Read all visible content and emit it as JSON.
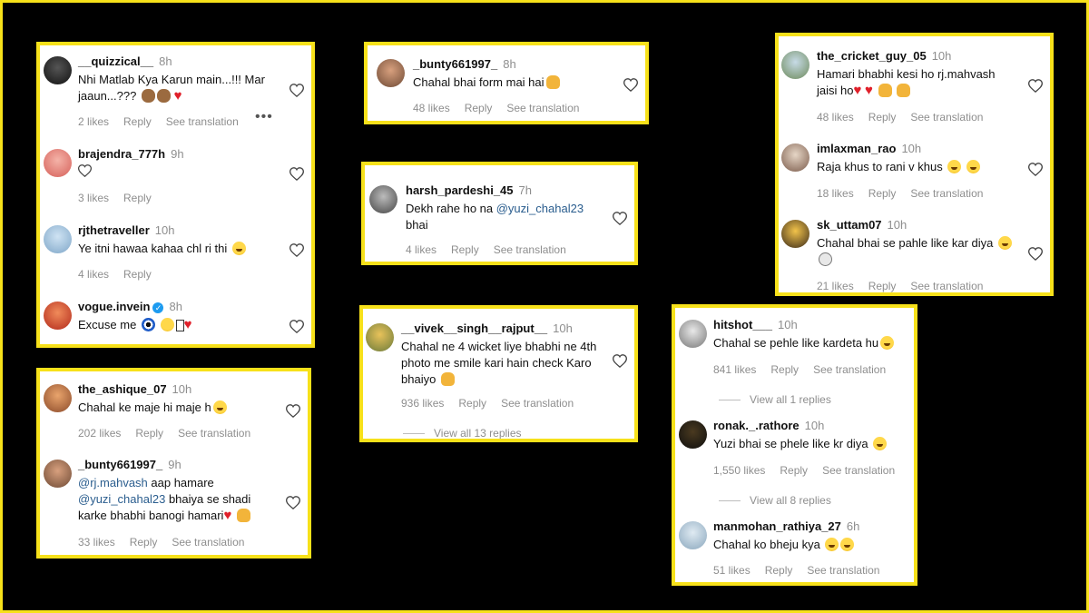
{
  "cards": {
    "c1": [
      {
        "user": "__quizzical__",
        "time": "8h",
        "text": "Nhi Matlab Kya Karun main...!!! Mar jaaun...???",
        "likes": "2 likes",
        "reply": "Reply",
        "translate": "See translation"
      },
      {
        "user": "brajendra_777h",
        "time": "9h",
        "text": "",
        "likes": "3 likes",
        "reply": "Reply"
      },
      {
        "user": "rjthetraveller",
        "time": "10h",
        "text": "Ye itni hawaa kahaa chl ri thi",
        "likes": "4 likes",
        "reply": "Reply"
      },
      {
        "user": "vogue.invein",
        "time": "8h",
        "text": "Excuse me",
        "likes": "",
        "reply": ""
      }
    ],
    "c2": [
      {
        "user": "the_ashique_07",
        "time": "10h",
        "text": "Chahal ke maje hi maje h",
        "likes": "202 likes",
        "reply": "Reply",
        "translate": "See translation"
      },
      {
        "user": "_bunty661997_",
        "time": "9h",
        "m1": "@rj.mahvash",
        "t1": " aap hamare ",
        "m2": "@yuzi_chahal23",
        "t2": " bhaiya se shadi karke bhabhi banogi hamari",
        "likes": "33 likes",
        "reply": "Reply",
        "translate": "See translation"
      }
    ],
    "c3": [
      {
        "user": "_bunty661997_",
        "time": "8h",
        "text": "Chahal bhai form mai hai",
        "likes": "48 likes",
        "reply": "Reply",
        "translate": "See translation"
      }
    ],
    "c4": [
      {
        "user": "harsh_pardeshi_45",
        "time": "7h",
        "t1": "Dekh rahe ho na ",
        "m1": "@yuzi_chahal23",
        "t2": " bhai",
        "likes": "4 likes",
        "reply": "Reply",
        "translate": "See translation"
      }
    ],
    "c5": [
      {
        "user": "__vivek__singh__rajput__",
        "time": "10h",
        "text": "Chahal ne 4 wicket liye bhabhi ne 4th photo me smile kari hain check Karo bhaiyo",
        "likes": "936 likes",
        "reply": "Reply",
        "translate": "See translation",
        "replies": "View all 13 replies"
      }
    ],
    "c6": [
      {
        "user": "the_cricket_guy_05",
        "time": "10h",
        "text": "Hamari bhabhi kesi ho rj.mahvash jaisi ho",
        "likes": "48 likes",
        "reply": "Reply",
        "translate": "See translation"
      },
      {
        "user": "imlaxman_rao",
        "time": "10h",
        "text": "Raja khus to rani v khus",
        "likes": "18 likes",
        "reply": "Reply",
        "translate": "See translation"
      },
      {
        "user": "sk_uttam07",
        "time": "10h",
        "text": "Chahal bhai se pahle like kar diya",
        "likes": "21 likes",
        "reply": "Reply",
        "translate": "See translation"
      }
    ],
    "c7": [
      {
        "user": "hitshot___",
        "time": "10h",
        "text": "Chahal se pehle like kardeta hu",
        "likes": "841 likes",
        "reply": "Reply",
        "translate": "See translation",
        "replies": "View all 1 replies"
      },
      {
        "user": "ronak._.rathore",
        "time": "10h",
        "text": "Yuzi bhai se phele like kr diya",
        "likes": "1,550 likes",
        "reply": "Reply",
        "translate": "See translation",
        "replies": "View all 8 replies"
      },
      {
        "user": "manmohan_rathiya_27",
        "time": "6h",
        "text": "Chahal ko bheju kya",
        "likes": "51 likes",
        "reply": "Reply",
        "translate": "See translation"
      }
    ]
  },
  "colors": {
    "highlight": "#f7e11a",
    "background": "#000000",
    "mention": "#2a5d8e"
  },
  "icons": [
    "heart-outline-icon",
    "more-dots-icon",
    "verified-badge-icon"
  ]
}
